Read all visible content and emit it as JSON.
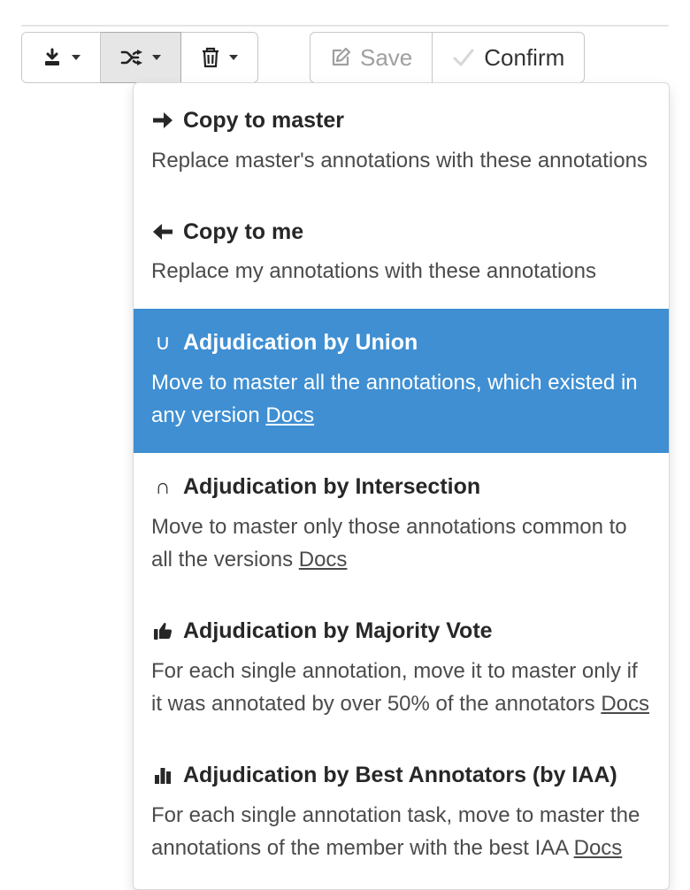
{
  "toolbar": {
    "save_label": "Save",
    "confirm_label": "Confirm"
  },
  "menu": {
    "items": [
      {
        "title": "Copy to master",
        "desc": "Replace master's annotations with these annotations",
        "docs": null
      },
      {
        "title": "Copy to me",
        "desc": "Replace my annotations with these annotations",
        "docs": null
      },
      {
        "title": "Adjudication by Union",
        "desc": "Move to master all the annotations, which existed in any version ",
        "docs": "Docs"
      },
      {
        "title": "Adjudication by Intersection",
        "desc": "Move to master only those annotations common to all the versions ",
        "docs": "Docs"
      },
      {
        "title": "Adjudication by Majority Vote",
        "desc": "For each single annotation, move it to master only if it was annotated by over 50% of the annotators ",
        "docs": "Docs"
      },
      {
        "title": "Adjudication by Best Annotators (by IAA)",
        "desc": "For each single annotation task, move to master the annotations of the member with the best IAA ",
        "docs": "Docs"
      }
    ]
  }
}
